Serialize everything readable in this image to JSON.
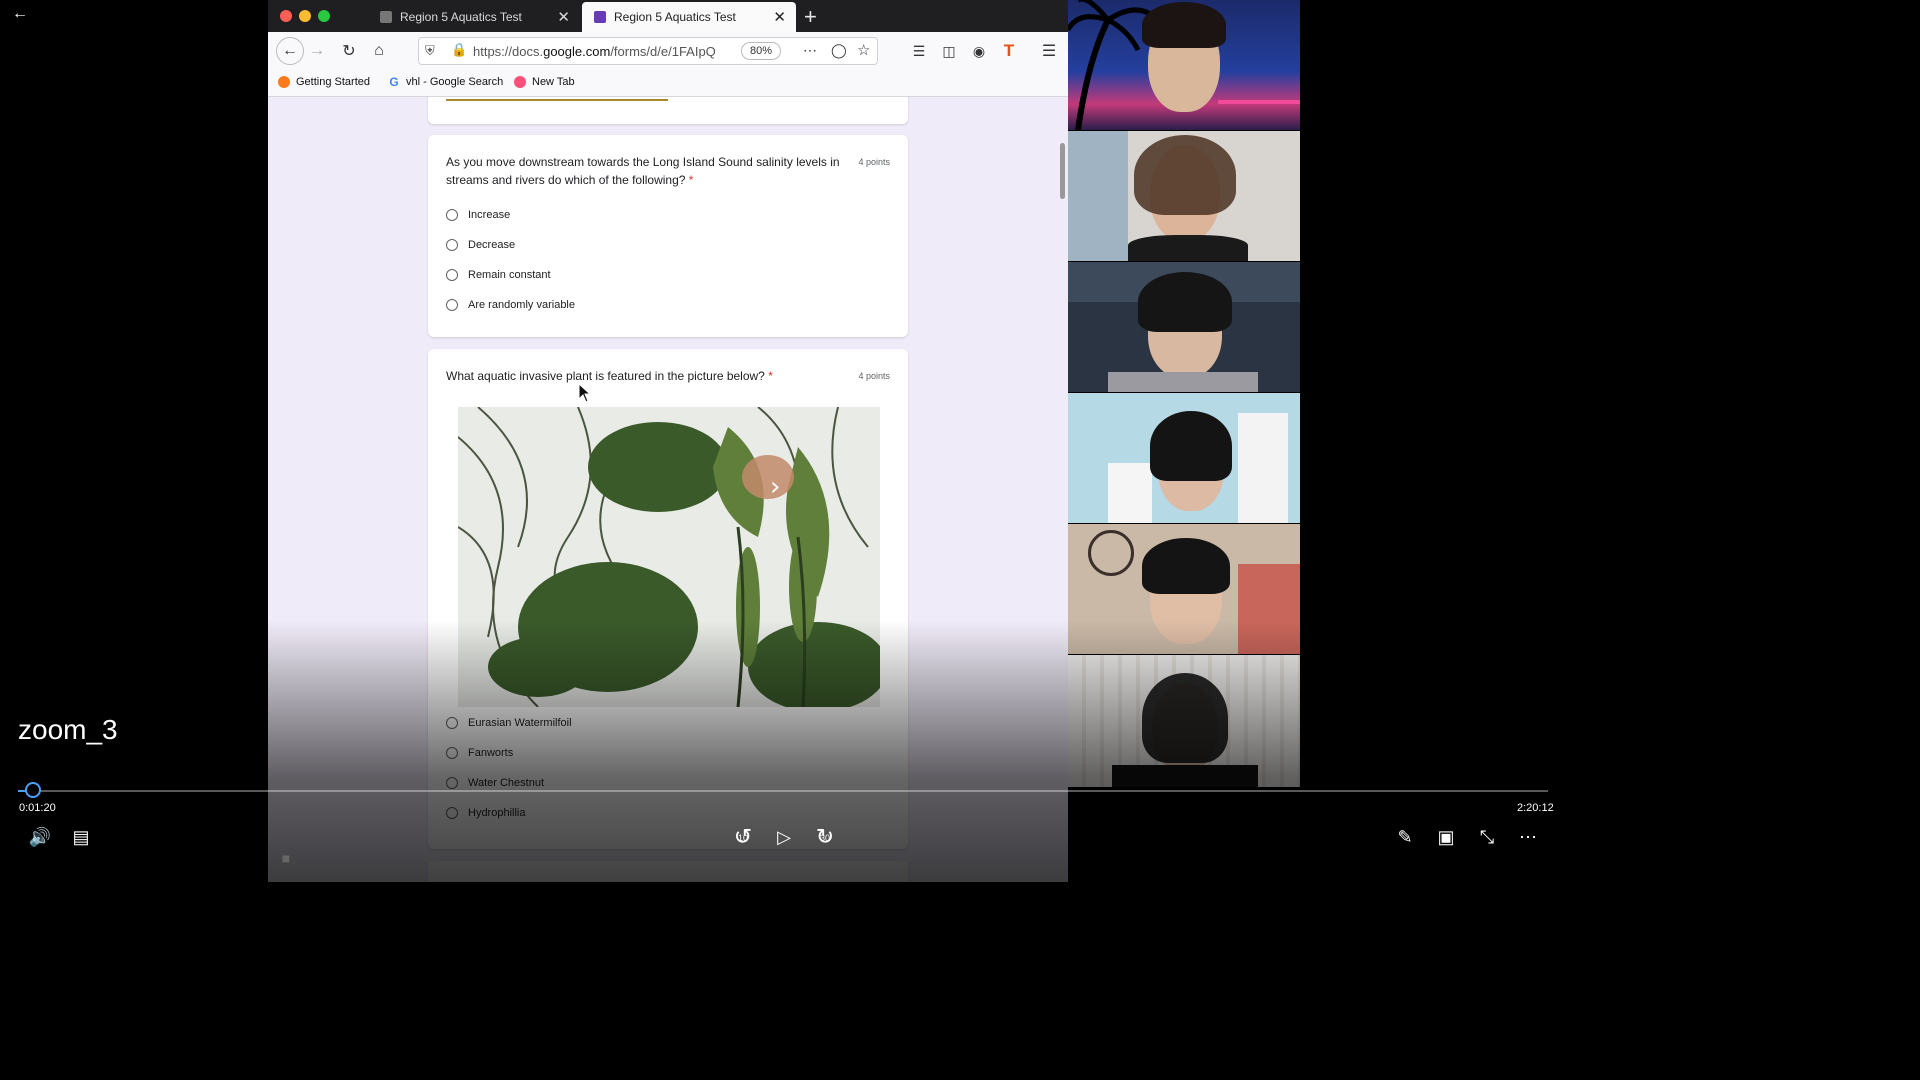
{
  "player": {
    "title": "zoom_3",
    "elapsed": "0:01:20",
    "duration": "2:20:12",
    "progress_fraction": 0.01,
    "skip_back_label": "10",
    "skip_forward_label": "30"
  },
  "browser": {
    "tabs": [
      {
        "label": "Region 5 Aquatics Test",
        "active": false
      },
      {
        "label": "Region 5 Aquatics Test",
        "active": true
      }
    ],
    "url": {
      "prefix": "https://docs.",
      "domain": "google.com",
      "rest": "/forms/d/e/1FAIpQ"
    },
    "zoom": "80%",
    "bookmarks": [
      {
        "label": "Getting Started",
        "icon": "firefox-icon"
      },
      {
        "label": "vhl - Google Search",
        "icon": "google-icon"
      },
      {
        "label": "New Tab",
        "icon": "firefox-icon"
      }
    ]
  },
  "form": {
    "questions": [
      {
        "text": "As you move downstream towards the Long Island Sound salinity levels in streams and rivers do which of the following?",
        "required_mark": "*",
        "points": "4 points",
        "options": [
          "Increase",
          "Decrease",
          "Remain constant",
          "Are randomly variable"
        ]
      },
      {
        "text": "What aquatic invasive plant is featured in the picture below?",
        "required_mark": "*",
        "points": "4 points",
        "options": [
          "Eurasian Watermilfoil",
          "Fanworts",
          "Water Chestnut",
          "Hydrophillia"
        ]
      }
    ]
  },
  "colors": {
    "accent_progress": "#4aa0ff",
    "required": "#d93025",
    "form_background": "#f0ebf8"
  }
}
